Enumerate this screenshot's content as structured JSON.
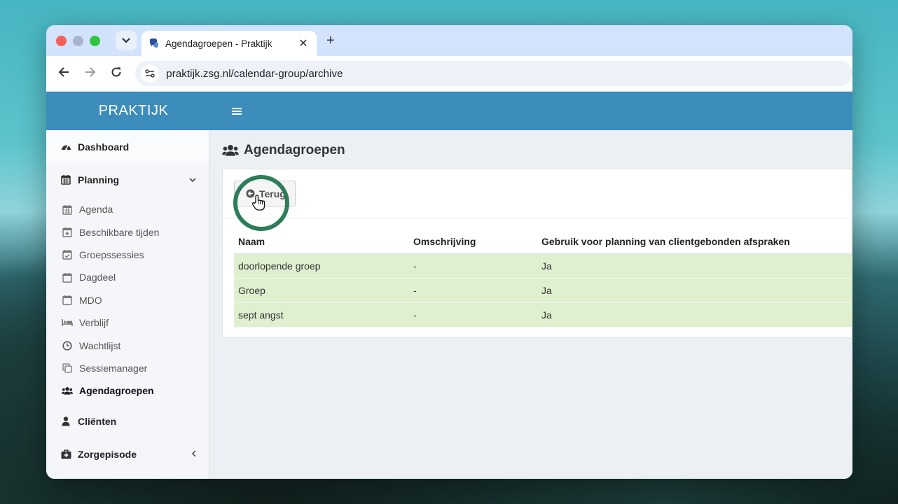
{
  "browser": {
    "tab_title": "Agendagroepen - Praktijk",
    "url": "praktijk.zsg.nl/calendar-group/archive",
    "new_tab_symbol": "+",
    "close_symbol": "✕"
  },
  "app": {
    "logo": "PRAKTIJK",
    "brand_color": "#3c8dbc"
  },
  "sidebar": {
    "dashboard": "Dashboard",
    "planning": "Planning",
    "planning_items": [
      {
        "label": "Agenda",
        "icon": "calendar-icon"
      },
      {
        "label": "Beschikbare tijden",
        "icon": "calendar-plus-icon"
      },
      {
        "label": "Groepssessies",
        "icon": "calendar-check-icon"
      },
      {
        "label": "Dagdeel",
        "icon": "calendar-icon"
      },
      {
        "label": "MDO",
        "icon": "calendar-icon"
      },
      {
        "label": "Verblijf",
        "icon": "bed-icon"
      },
      {
        "label": "Wachtlijst",
        "icon": "clock-icon"
      },
      {
        "label": "Sessiemanager",
        "icon": "copy-icon"
      },
      {
        "label": "Agendagroepen",
        "icon": "users-icon"
      }
    ],
    "clienten": "Cliënten",
    "zorgepisode": "Zorgepisode"
  },
  "main": {
    "title": "Agendagroepen",
    "back_label": "Terug",
    "table": {
      "headers": [
        "Naam",
        "Omschrijving",
        "Gebruik voor planning van clientgebonden afspraken"
      ],
      "rows": [
        [
          "doorlopende groep",
          "-",
          "Ja"
        ],
        [
          "Groep",
          "-",
          "Ja"
        ],
        [
          "sept angst",
          "-",
          "Ja"
        ]
      ],
      "row_color": "#dff0d0"
    }
  }
}
